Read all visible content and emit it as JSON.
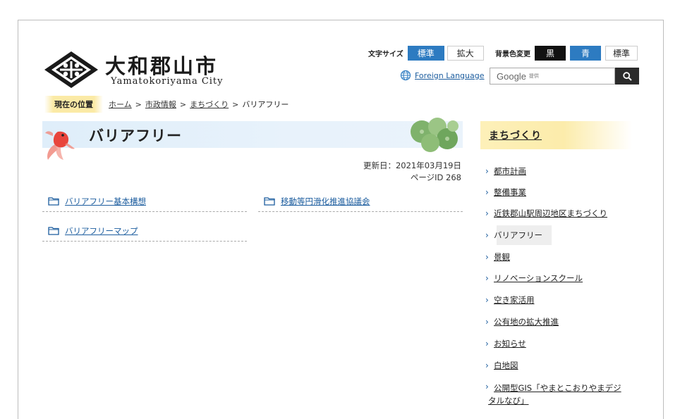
{
  "header": {
    "city_name_jp": "大和郡山市",
    "city_name_en": "Yamatokoriyama City",
    "font_size_label": "文字サイズ",
    "font_size_standard": "標準",
    "font_size_large": "拡大",
    "bg_color_label": "背景色変更",
    "bg_black": "黒",
    "bg_blue": "青",
    "bg_standard": "標準",
    "foreign_language": "Foreign Language",
    "search_brand": "Google",
    "search_provided": "提供"
  },
  "breadcrumb": {
    "label": "現在の位置",
    "items": [
      "ホーム",
      "市政情報",
      "まちづくり"
    ],
    "current": "バリアフリー",
    "separator": ">"
  },
  "main": {
    "title": "バリアフリー",
    "updated": "更新日：2021年03月19日",
    "page_id": "ページID 268",
    "links": [
      "バリアフリー基本構想",
      "移動等円滑化推進協議会",
      "バリアフリーマップ"
    ]
  },
  "sidebar": {
    "heading": "まちづくり",
    "items": [
      "都市計画",
      "整備事業",
      "近鉄郡山駅周辺地区まちづくり",
      "バリアフリー",
      "景観",
      "リノベーションスクール",
      "空き家活用",
      "公有地の拡大推進",
      "お知らせ",
      "白地図",
      "公開型GIS「やまとこおりやまデジ",
      "タルなび」"
    ]
  },
  "colors": {
    "accent_blue": "#2d7bc1",
    "link_blue": "#1b5c9e",
    "banner_bg": "#dfeefa",
    "sidebar_heading_bg": "#fcecab",
    "breadcrumb_label_bg": "#fbeaa6"
  }
}
